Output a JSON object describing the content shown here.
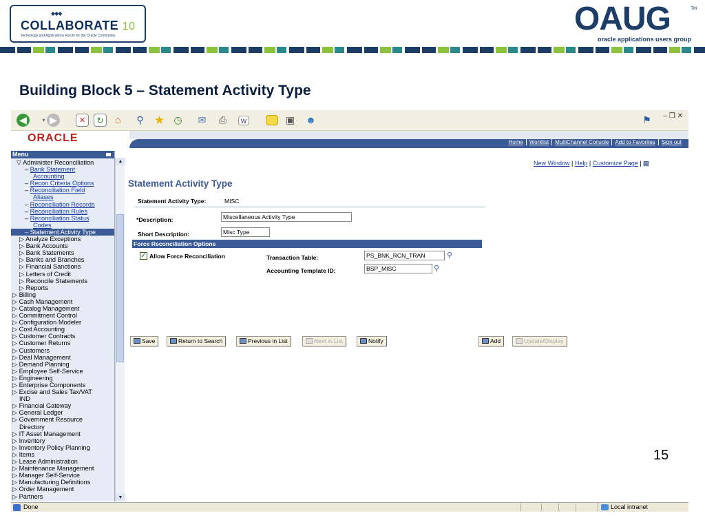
{
  "slide": {
    "left_logo": {
      "brand": "COLLABORATE",
      "number": "10",
      "tagline": "Technology and Applications Forum for the Oracle Community"
    },
    "right_logo": {
      "brand": "OAUG",
      "tm": "TM",
      "tagline": "oracle applications users group"
    },
    "title": "Building Block 5 – Statement Activity Type",
    "page_number": "15",
    "stripe_colors": [
      "#1b3d66",
      "#8bc33f",
      "#2a8a8a"
    ]
  },
  "browser": {
    "window_controls": "–  ❒  ✕",
    "status": "Done",
    "zone": "Local intranet"
  },
  "oracle": {
    "logo": "ORACLE",
    "nav": [
      "Home",
      "Worklist",
      "MultiChannel Console",
      "Add to Favorites",
      "Sign out"
    ]
  },
  "menu": {
    "header": "Menu",
    "items": [
      {
        "text": "▽ Administer Reconciliation",
        "type": "open",
        "indent": 8
      },
      {
        "text": "Bank Statement",
        "type": "sub",
        "indent": 20
      },
      {
        "text": "Accounting",
        "type": "sub-cont",
        "indent": 32
      },
      {
        "text": "Recon Criteria Options",
        "type": "sub",
        "indent": 20
      },
      {
        "text": "Reconciliation Field",
        "type": "sub",
        "indent": 20
      },
      {
        "text": "Aliases",
        "type": "sub-cont",
        "indent": 32
      },
      {
        "text": "Reconciliation Records",
        "type": "sub",
        "indent": 20
      },
      {
        "text": "Reconciliation Rules",
        "type": "sub",
        "indent": 20
      },
      {
        "text": "Reconciliation Status",
        "type": "sub",
        "indent": 20
      },
      {
        "text": "Codes",
        "type": "sub-cont",
        "indent": 32
      },
      {
        "text": "Statement Activity Type",
        "type": "sel",
        "indent": 20
      },
      {
        "text": "▷ Analyze Exceptions",
        "type": "item",
        "indent": 12
      },
      {
        "text": "▷ Bank Accounts",
        "type": "item",
        "indent": 12
      },
      {
        "text": "▷ Bank Statements",
        "type": "item",
        "indent": 12
      },
      {
        "text": "▷ Banks and Branches",
        "type": "item",
        "indent": 12
      },
      {
        "text": "▷ Financial Sanctions",
        "type": "item",
        "indent": 12
      },
      {
        "text": "▷ Letters of Credit",
        "type": "item",
        "indent": 12
      },
      {
        "text": "▷ Reconcile Statements",
        "type": "item",
        "indent": 12
      },
      {
        "text": "▷ Reports",
        "type": "item",
        "indent": 12
      },
      {
        "text": "▷ Billing",
        "type": "item",
        "indent": 2
      },
      {
        "text": "▷ Cash Management",
        "type": "item",
        "indent": 2
      },
      {
        "text": "▷ Catalog Management",
        "type": "item",
        "indent": 2
      },
      {
        "text": "▷ Commitment Control",
        "type": "item",
        "indent": 2
      },
      {
        "text": "▷ Configuration Modeler",
        "type": "item",
        "indent": 2
      },
      {
        "text": "▷ Cost Accounting",
        "type": "item",
        "indent": 2
      },
      {
        "text": "▷ Customer Contracts",
        "type": "item",
        "indent": 2
      },
      {
        "text": "▷ Customer Returns",
        "type": "item",
        "indent": 2
      },
      {
        "text": "▷ Customers",
        "type": "item",
        "indent": 2
      },
      {
        "text": "▷ Deal Management",
        "type": "item",
        "indent": 2
      },
      {
        "text": "▷ Demand Planning",
        "type": "item",
        "indent": 2
      },
      {
        "text": "▷ Employee Self-Service",
        "type": "item",
        "indent": 2
      },
      {
        "text": "▷ Engineering",
        "type": "item",
        "indent": 2
      },
      {
        "text": "▷ Enterprise Components",
        "type": "item",
        "indent": 2
      },
      {
        "text": "▷ Excise and Sales Tax/VAT",
        "type": "item",
        "indent": 2
      },
      {
        "text": "IND",
        "type": "cont",
        "indent": 12
      },
      {
        "text": "▷ Financial Gateway",
        "type": "item",
        "indent": 2
      },
      {
        "text": "▷ General Ledger",
        "type": "item",
        "indent": 2
      },
      {
        "text": "▷ Government Resource",
        "type": "item",
        "indent": 2
      },
      {
        "text": "Directory",
        "type": "cont",
        "indent": 12
      },
      {
        "text": "▷ IT Asset Management",
        "type": "item",
        "indent": 2
      },
      {
        "text": "▷ Inventory",
        "type": "item",
        "indent": 2
      },
      {
        "text": "▷ Inventory Policy Planning",
        "type": "item",
        "indent": 2
      },
      {
        "text": "▷ Items",
        "type": "item",
        "indent": 2
      },
      {
        "text": "▷ Lease Administration",
        "type": "item",
        "indent": 2
      },
      {
        "text": "▷ Maintenance Management",
        "type": "item",
        "indent": 2
      },
      {
        "text": "▷ Manager Self-Service",
        "type": "item",
        "indent": 2
      },
      {
        "text": "▷ Manufacturing Definitions",
        "type": "item",
        "indent": 2
      },
      {
        "text": "▷ Order Management",
        "type": "item",
        "indent": 2
      },
      {
        "text": "▷ Partners",
        "type": "item",
        "indent": 2
      }
    ]
  },
  "page": {
    "links": {
      "new_window": "New Window",
      "help": "Help",
      "customize": "Customize Page"
    },
    "heading": "Statement Activity Type",
    "activity_type_label": "Statement Activity Type:",
    "activity_type_value": "MISC",
    "description_label": "*Description:",
    "description_value": "Miscellaneous Activity Type",
    "short_desc_label": "Short Description:",
    "short_desc_value": "Misc Type",
    "section_title": "Force Reconciliation Options",
    "allow_force_label": "Allow Force Reconciliation",
    "allow_force_checked": true,
    "transaction_table_label": "Transaction Table:",
    "transaction_table_value": "PS_BNK_RCN_TRAN",
    "acct_template_label": "Accounting Template ID:",
    "acct_template_value": "BSP_MISC"
  },
  "buttons": {
    "save": "Save",
    "return_to_search": "Return to Search",
    "previous_in_list": "Previous in List",
    "next_in_list": "Next in List",
    "notify": "Notify",
    "add": "Add",
    "update_display": "Update/Display"
  }
}
